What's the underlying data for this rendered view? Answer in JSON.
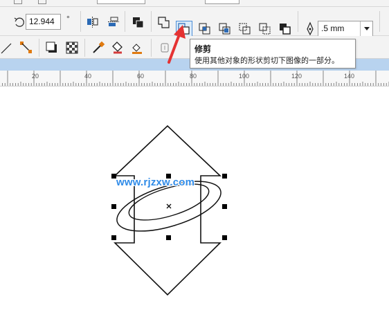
{
  "toolbar": {
    "rotation_value": "12.944",
    "rotation_unit": "°",
    "outline_width_value": ".5 mm",
    "icons": [
      "rotate-icon",
      "mirror-icon",
      "align-icon",
      "combine-icon",
      "weld-icon",
      "trim-icon",
      "intersect-icon",
      "simplify-icon",
      "front-minus-back-icon",
      "back-minus-front-icon",
      "boundary-icon",
      "pen-icon",
      "dropdown-arrow-icon"
    ],
    "active_tool": "trim-button"
  },
  "tooltip": {
    "title": "修剪",
    "description": "使用其他对象的形状剪切下图像的一部分。"
  },
  "ruler": {
    "labels": [
      "20",
      "40",
      "60",
      "80",
      "100",
      "120",
      "140"
    ]
  },
  "canvas": {
    "watermark": "www.rjzxw.com"
  },
  "colors": {
    "accent": "#4a8ed8",
    "active_bg": "#dcebf9",
    "arrow": "#e53333",
    "watermark": "#2f8be8",
    "toolbar_bg": "#f3f3f3",
    "band": "#b8d3ef"
  }
}
